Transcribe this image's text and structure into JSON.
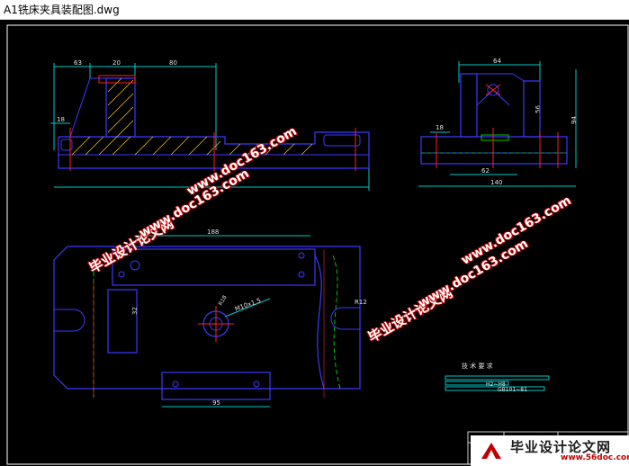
{
  "window": {
    "title": "A1铣床夹具装配图.dwg"
  },
  "drawing": {
    "front_view": {
      "dim_63": "63",
      "dim_20": "20",
      "dim_80": "80",
      "dim_18": "18"
    },
    "side_view": {
      "dim_64": "64",
      "dim_56": "56",
      "dim_94": "94",
      "dim_18": "18",
      "dim_62": "62",
      "dim_140": "140"
    },
    "top_view": {
      "dim_188": "188",
      "dim_32": "32",
      "dim_95": "95",
      "thread": "M10x1.5",
      "dim_r12": "R12",
      "dim_r18": "R18"
    },
    "notes": {
      "title": "技 术 要 求",
      "line2": "H2~H8",
      "line3": "GB101~81"
    },
    "colors": {
      "outline": "#3a3aff",
      "dimension": "#00c8c8",
      "center": "#ff2020",
      "hatch": "#ffcc00",
      "text": "#e0e0e0"
    }
  },
  "watermarks": {
    "site_cn": "毕业设计论文网",
    "site_url": "www.doc163.com"
  },
  "logo": {
    "name": "毕业设计论文网",
    "url": "www.56doc.com"
  }
}
